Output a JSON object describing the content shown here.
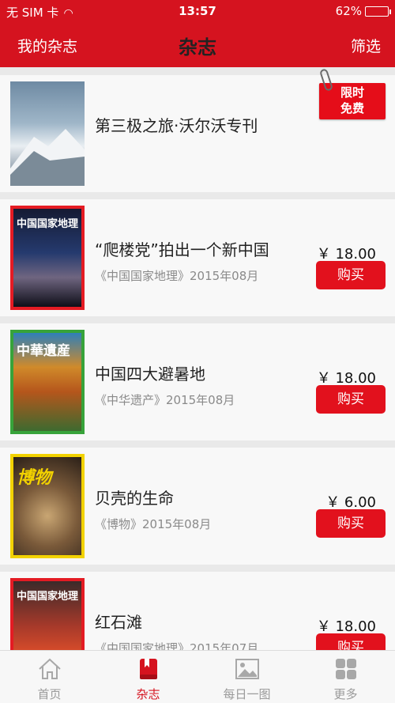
{
  "status": {
    "carrier": "无 SIM 卡",
    "time": "13:57",
    "battery": "62%",
    "battery_level": 0.62
  },
  "nav": {
    "left": "我的杂志",
    "title": "杂志",
    "right": "筛选"
  },
  "promo": {
    "title": "第三极之旅·沃尔沃专刊",
    "ribbon_line1": "限时",
    "ribbon_line2": "免费"
  },
  "items": [
    {
      "title": "“爬楼党”拍出一个新中国",
      "source": "《中国国家地理》2015年08月",
      "price": "￥ 18.00",
      "buy": "购买",
      "masthead": "中国国家地理"
    },
    {
      "title": "中国四大避暑地",
      "source": "《中华遗产》2015年08月",
      "price": "￥ 18.00",
      "buy": "购买",
      "masthead": "中華遺産"
    },
    {
      "title": "贝壳的生命",
      "source": "《博物》2015年08月",
      "price": "￥ 6.00",
      "buy": "购买",
      "masthead": "博物"
    },
    {
      "title": "红石滩",
      "source": "《中国国家地理》2015年07月",
      "price": "￥ 18.00",
      "buy": "购买",
      "masthead": "中国国家地理"
    }
  ],
  "tabs": [
    {
      "label": "首页",
      "icon": "home-icon"
    },
    {
      "label": "杂志",
      "icon": "book-icon",
      "active": true
    },
    {
      "label": "每日一图",
      "icon": "image-icon"
    },
    {
      "label": "更多",
      "icon": "grid-icon"
    }
  ],
  "colors": {
    "accent": "#d5131f",
    "button": "#e2111d"
  }
}
